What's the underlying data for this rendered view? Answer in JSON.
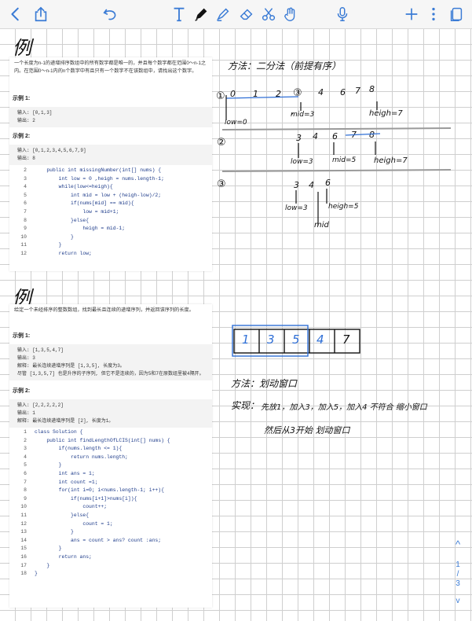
{
  "toolbar": {
    "icons": [
      "back-chevron-icon",
      "share-icon",
      "undo-icon",
      "text-tool-icon",
      "pen-icon",
      "highlighter-icon",
      "eraser-icon",
      "lasso-icon",
      "hand-icon",
      "microphone-icon",
      "add-icon",
      "more-icon",
      "pages-icon"
    ],
    "accent": "#3a7bd5"
  },
  "section1": {
    "label": "例",
    "problem": "一个长度为n-1的递增排序数组中的所有数字都是唯一的，并且每个数字都在范围0～n-1之内。在范围0～n-1内的n个数字中有且只有一个数字不在该数组中，请找出这个数字。",
    "ex1_title": "示例 1:",
    "ex1_in": "输入: [0,1,3]",
    "ex1_out": "输出: 2",
    "ex2_title": "示例 2:",
    "ex2_in": "输入: [0,1,2,3,4,5,6,7,9]",
    "ex2_out": "输出: 8",
    "code": [
      {
        "n": "2",
        "t": "    public int missingNumber(int[] nums) {"
      },
      {
        "n": "3",
        "t": "        int low = 0 ,heigh = nums.length-1;"
      },
      {
        "n": "4",
        "t": "        while(low<=heigh){"
      },
      {
        "n": "5",
        "t": "            int mid = low + (heigh-low)/2;"
      },
      {
        "n": "6",
        "t": "            if(nums[mid] == mid){"
      },
      {
        "n": "7",
        "t": "                low = mid+1;"
      },
      {
        "n": "8",
        "t": "            }else{"
      },
      {
        "n": "9",
        "t": "                heigh = mid-1;"
      },
      {
        "n": "10",
        "t": "            }"
      },
      {
        "n": "11",
        "t": "        }"
      },
      {
        "n": "12",
        "t": "        return low;"
      }
    ]
  },
  "notes1": {
    "method": "方法：二分法（前提有序）",
    "step1": "①",
    "step2": "②",
    "step3": "③",
    "s1_nums": [
      "0",
      "1",
      "2",
      "③",
      "4",
      "6",
      "7",
      "8"
    ],
    "s1_low": "low=0",
    "s1_mid": "mid=3",
    "s1_heigh": "heigh=7",
    "s2_nums": [
      "3",
      "4",
      "6",
      "7",
      "8"
    ],
    "s2_low": "low=3",
    "s2_mid": "mid=5",
    "s2_heigh": "heigh=7",
    "s3_nums": [
      "3",
      "4",
      "6"
    ],
    "s3_low": "low=3",
    "s3_heigh": "heigh=5",
    "s3_mid": "mid"
  },
  "section2": {
    "label": "例",
    "problem": "给定一个未经排序的整数数组，找到最长且连续的递增序列，并返回该序列的长度。",
    "ex1_title": "示例 1:",
    "ex1_in": "输入: [1,3,5,4,7]",
    "ex1_out": "输出: 3",
    "ex1_exp": "解释: 最长连续递增序列是 [1,3,5], 长度为3。",
    "ex1_exp2": "尽管 [1,3,5,7] 也是升序的子序列, 但它不是连续的，因为5和7在原数组里被4隔开。",
    "ex2_title": "示例 2:",
    "ex2_in": "输入: [2,2,2,2,2]",
    "ex2_out": "输出: 1",
    "ex2_exp": "解释: 最长连续递增序列是 [2], 长度为1。",
    "code": [
      {
        "n": "1",
        "t": "class Solution {"
      },
      {
        "n": "2",
        "t": "    public int findLengthOfLCIS(int[] nums) {"
      },
      {
        "n": "3",
        "t": "        if(nums.length <= 1){"
      },
      {
        "n": "4",
        "t": "            return nums.length;"
      },
      {
        "n": "5",
        "t": "        }"
      },
      {
        "n": "6",
        "t": "        int ans = 1;"
      },
      {
        "n": "7",
        "t": "        int count =1;"
      },
      {
        "n": "8",
        "t": "        for(int i=0; i<nums.length-1; i++){"
      },
      {
        "n": "9",
        "t": "            if(nums[i+1]>nums[i]){"
      },
      {
        "n": "10",
        "t": "                count++;"
      },
      {
        "n": "11",
        "t": "            }else{"
      },
      {
        "n": "12",
        "t": "                count = 1;"
      },
      {
        "n": "13",
        "t": "            }"
      },
      {
        "n": "14",
        "t": "            ans = count > ans? count :ans;"
      },
      {
        "n": "15",
        "t": "        }"
      },
      {
        "n": "16",
        "t": "        return ans;"
      },
      {
        "n": "17",
        "t": "    }"
      },
      {
        "n": "18",
        "t": "}"
      }
    ]
  },
  "notes2": {
    "cells": [
      "1",
      "3",
      "5",
      "4",
      "7"
    ],
    "method": "方法：划动窗口",
    "impl_label": "实现：",
    "impl": "先放1，加入3，加入5，加入4 不符合 缩小窗口",
    "then": "然后从3开始 划动窗口"
  },
  "pager": {
    "up": "^",
    "current": "1",
    "sep": "/",
    "total": "3",
    "down": "v"
  }
}
